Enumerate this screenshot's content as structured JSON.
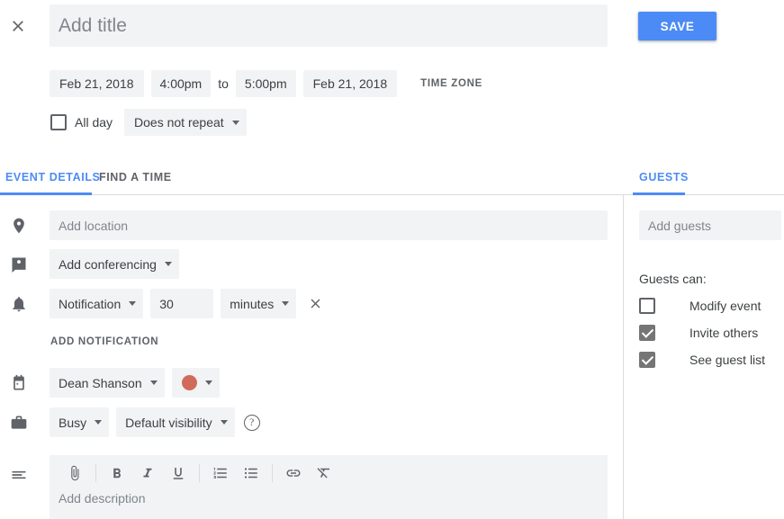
{
  "header": {
    "close_icon": "close-icon",
    "title_placeholder": "Add title",
    "save_label": "SAVE"
  },
  "datetime": {
    "start_date": "Feb 21, 2018",
    "start_time": "4:00pm",
    "to_label": "to",
    "end_time": "5:00pm",
    "end_date": "Feb 21, 2018",
    "time_zone_label": "TIME ZONE",
    "all_day_label": "All day",
    "all_day_checked": false,
    "recurrence": "Does not repeat"
  },
  "tabs": {
    "left": [
      {
        "label": "EVENT DETAILS",
        "active": true
      },
      {
        "label": "FIND A TIME",
        "active": false
      }
    ],
    "right": [
      {
        "label": "GUESTS",
        "active": true
      }
    ]
  },
  "details": {
    "location_icon": "location-pin-icon",
    "location_placeholder": "Add location",
    "conferencing_icon": "conferencing-icon",
    "conferencing_label": "Add conferencing",
    "notification_icon": "bell-icon",
    "notification_type": "Notification",
    "notification_amount": "30",
    "notification_unit": "minutes",
    "remove_notification_icon": "close-icon",
    "add_notification_label": "ADD NOTIFICATION",
    "calendar_icon": "calendar-icon",
    "calendar_owner": "Dean Shanson",
    "event_color": "#d06b5c",
    "busy_icon": "briefcase-icon",
    "availability": "Busy",
    "visibility": "Default visibility",
    "help_icon": "help-icon",
    "help_glyph": "?"
  },
  "description": {
    "description_icon": "description-icon",
    "placeholder": "Add description",
    "toolbar": [
      {
        "name": "attach-icon",
        "label": "Attach file"
      },
      {
        "name": "bold-icon",
        "label": "B"
      },
      {
        "name": "italic-icon",
        "label": "I"
      },
      {
        "name": "underline-icon",
        "label": "U"
      },
      {
        "name": "numbered-list-icon",
        "label": "Numbered list"
      },
      {
        "name": "bulleted-list-icon",
        "label": "Bulleted list"
      },
      {
        "name": "link-icon",
        "label": "Insert link"
      },
      {
        "name": "clear-formatting-icon",
        "label": "Remove formatting"
      }
    ]
  },
  "guests": {
    "add_guests_placeholder": "Add guests",
    "guests_can_label": "Guests can:",
    "permissions": [
      {
        "label": "Modify event",
        "checked": false
      },
      {
        "label": "Invite others",
        "checked": true
      },
      {
        "label": "See guest list",
        "checked": true
      }
    ]
  },
  "colors": {
    "accent": "#4c8bf5",
    "field_bg": "#f1f3f4",
    "text": "#3c4043",
    "muted": "#5f6368",
    "placeholder": "#80868b",
    "divider": "#dadce0"
  }
}
